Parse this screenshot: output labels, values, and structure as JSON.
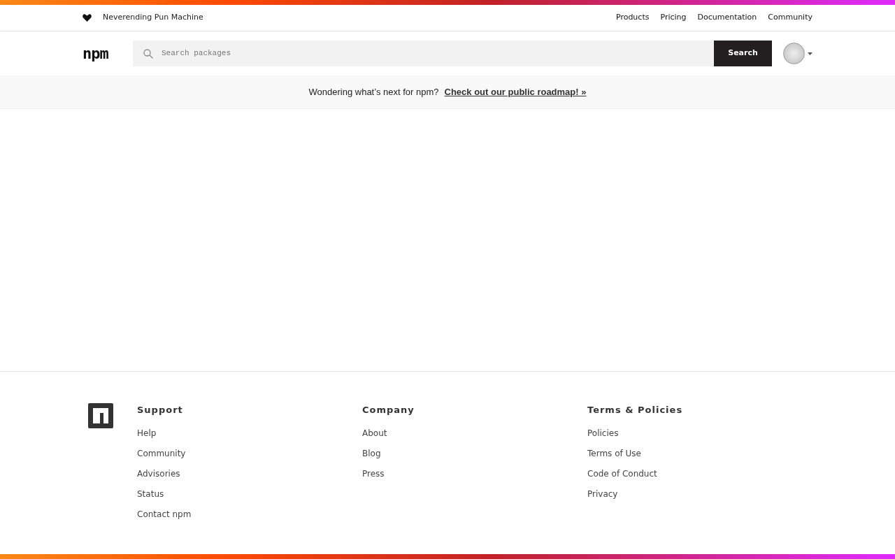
{
  "top_nav": {
    "tagline": "Neverending Pun Machine",
    "links": [
      "Products",
      "Pricing",
      "Documentation",
      "Community"
    ]
  },
  "header": {
    "logo": "npm",
    "search": {
      "placeholder": "Search packages"
    },
    "search_button": "Search"
  },
  "banner": {
    "text": "Wondering what’s next for npm?",
    "link": "Check out our public roadmap! »"
  },
  "footer": {
    "columns": [
      {
        "title": "Support",
        "links": [
          "Help",
          "Community",
          "Advisories",
          "Status",
          "Contact npm"
        ]
      },
      {
        "title": "Company",
        "links": [
          "About",
          "Blog",
          "Press"
        ]
      },
      {
        "title": "Terms & Policies",
        "links": [
          "Policies",
          "Terms of Use",
          "Code of Conduct",
          "Privacy"
        ]
      }
    ]
  }
}
